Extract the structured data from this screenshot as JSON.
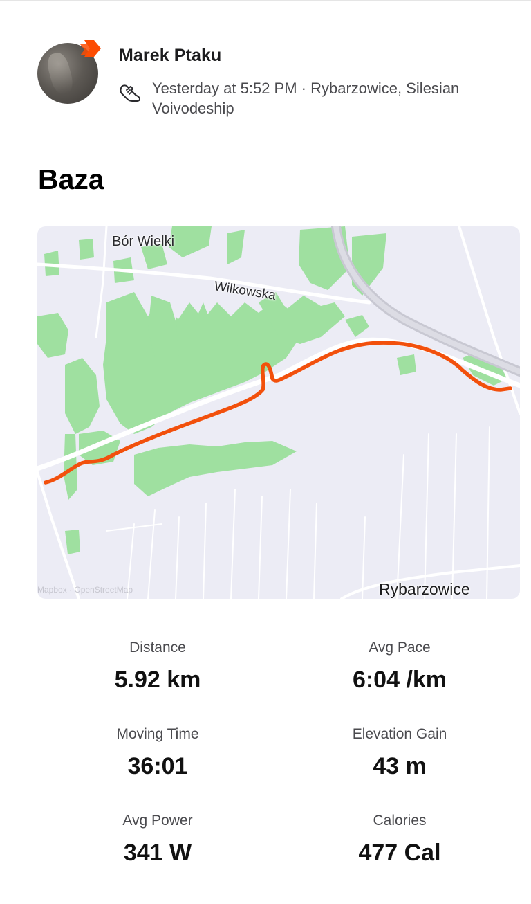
{
  "header": {
    "athlete_name": "Marek Ptaku",
    "activity_meta": "Yesterday at 5:52 PM · Rybarzowice, Silesian Voivodeship",
    "activity_type_icon": "running-shoe-icon"
  },
  "activity": {
    "title": "Baza"
  },
  "map": {
    "labels": {
      "village_north": "Bór Wielki",
      "street": "Wilkowska",
      "village_south": "Rybarzowice"
    },
    "attribution": "Mapbox · OpenStreetMap",
    "colors": {
      "background": "#ececf5",
      "forest": "#9fe0a0",
      "route": "#f2500c",
      "road": "#ffffff",
      "highway": "#cfcfd8"
    }
  },
  "stats": [
    {
      "label": "Distance",
      "value": "5.92 km"
    },
    {
      "label": "Avg Pace",
      "value": "6:04 /km"
    },
    {
      "label": "Moving Time",
      "value": "36:01"
    },
    {
      "label": "Elevation Gain",
      "value": "43 m"
    },
    {
      "label": "Avg Power",
      "value": "341 W"
    },
    {
      "label": "Calories",
      "value": "477 Cal"
    }
  ],
  "colors": {
    "accent": "#fc4c02",
    "text_primary": "#1c1c1e",
    "text_secondary": "#4a4a4e"
  }
}
